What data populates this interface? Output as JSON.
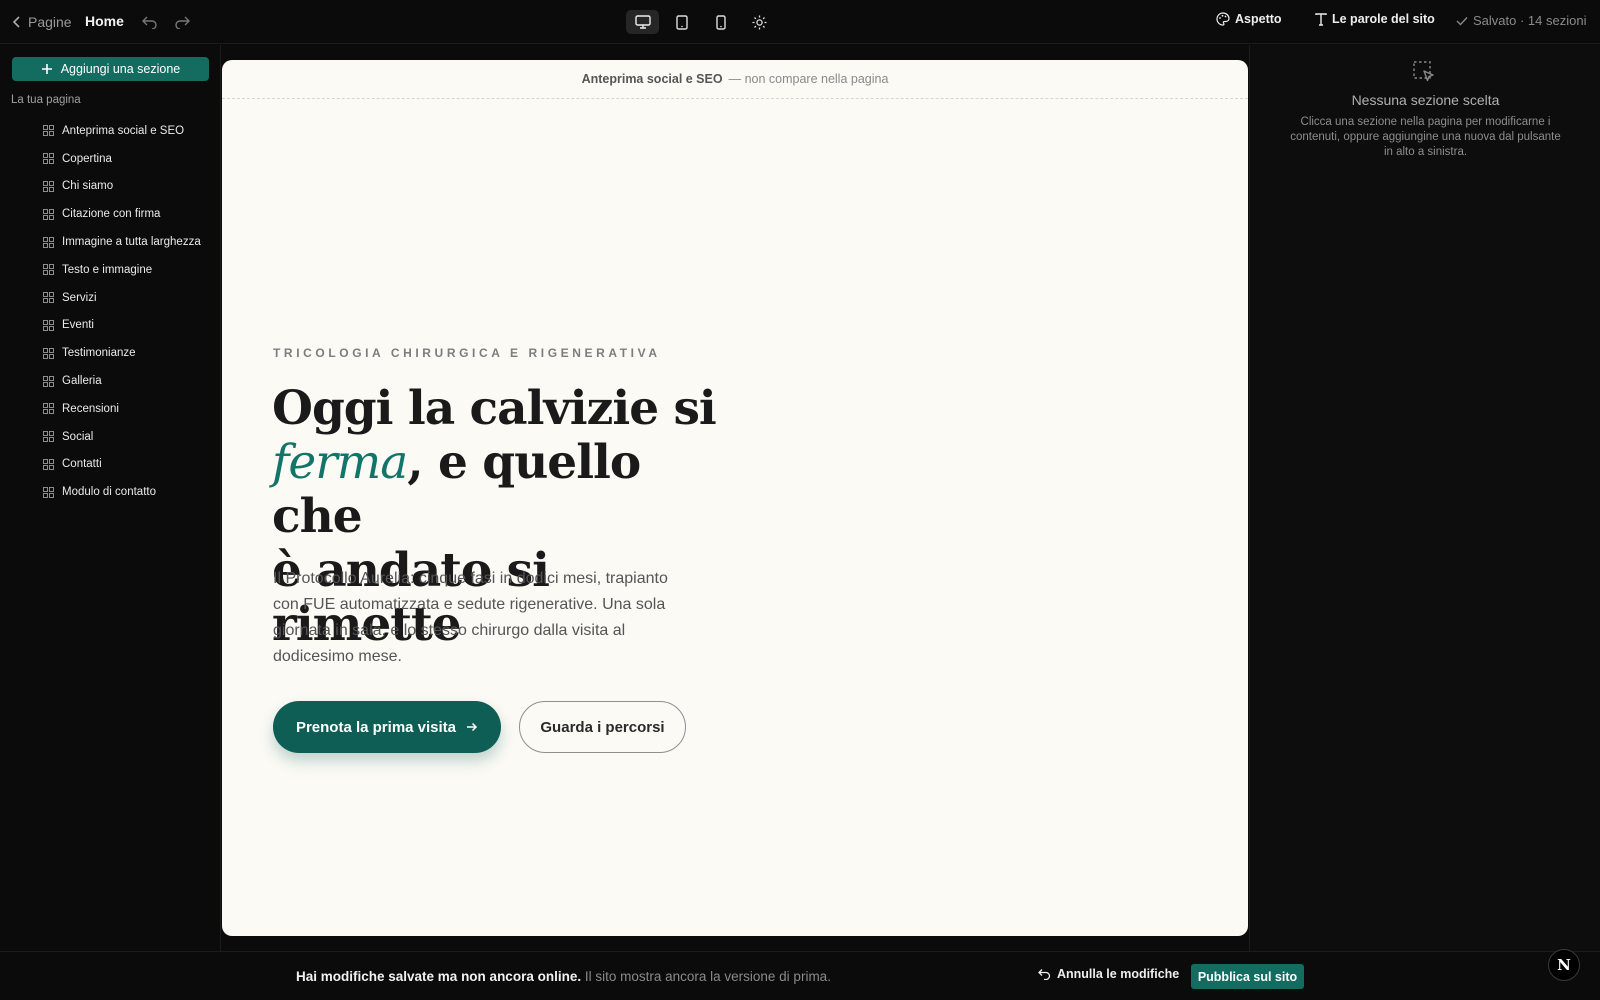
{
  "topbar": {
    "back_label": "Pagine",
    "page_name": "Home",
    "aspetto_label": "Aspetto",
    "parole_label": "Le parole del sito",
    "saved_status": "Salvato · 14 sezioni",
    "devices": [
      "desktop-icon",
      "tablet-icon",
      "mobile-icon",
      "sun-icon"
    ],
    "active_device": "desktop"
  },
  "sidebar": {
    "add_button": "Aggiungi una sezione",
    "title": "La tua pagina",
    "items": [
      "Anteprima social e SEO",
      "Copertina",
      "Chi siamo",
      "Citazione con firma",
      "Immagine a tutta larghezza",
      "Testo e immagine",
      "Servizi",
      "Eventi",
      "Testimonianze",
      "Galleria",
      "Recensioni",
      "Social",
      "Contatti",
      "Modulo di contatto"
    ]
  },
  "canvas": {
    "seo_strip_bold": "Anteprima social e SEO",
    "seo_strip_note": "— non compare nella pagina",
    "eyebrow": "TRICOLOGIA CHIRURGICA E RIGENERATIVA",
    "title_line1": "Oggi la calvizie si",
    "title_em": "ferma",
    "title_line2_rest": ", e quello che",
    "title_line3": "è andato si rimette",
    "body": "Il Protocollo Aurelia: cinque fasi in dodici mesi, trapianto con FUE automatizzata e sedute rigenerative. Una sola giornata in sala, e lo stesso chirurgo dalla visita al dodicesimo mese.",
    "primary_cta": "Prenota la prima visita",
    "secondary_cta": "Guarda i percorsi",
    "accent_color": "#13756a"
  },
  "right_panel": {
    "title": "Nessuna sezione scelta",
    "text": "Clicca una sezione nella pagina per modificarne i contenuti, oppure aggiungine una nuova dal pulsante in alto a sinistra."
  },
  "bottombar": {
    "message_strong": "Hai modifiche salvate ma non ancora online.",
    "message_rest": "Il sito mostra ancora la versione di prima.",
    "undo_label": "Annulla le modifiche",
    "publish_label": "Pubblica sul sito"
  },
  "avatar_letter": "N"
}
